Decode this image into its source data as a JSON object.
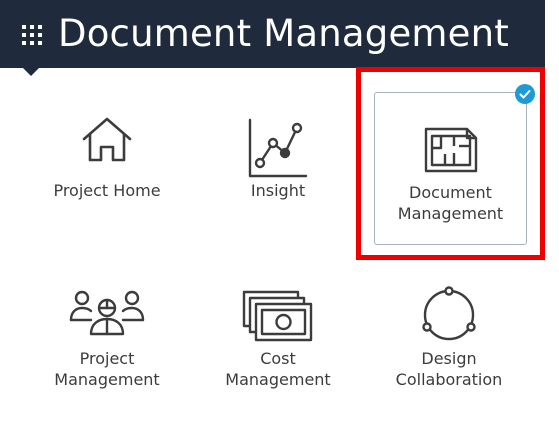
{
  "header": {
    "title": "Document Management",
    "menu_icon": "waffle-grid-icon",
    "background_color": "#1f2b3c"
  },
  "modules": [
    {
      "id": "project-home",
      "line1": "Project Home",
      "line2": "",
      "icon": "house-icon",
      "selected": false
    },
    {
      "id": "insight",
      "line1": "Insight",
      "line2": "",
      "icon": "line-chart-icon",
      "selected": false
    },
    {
      "id": "document-management",
      "line1": "Document",
      "line2": "Management",
      "icon": "floor-plan-document-icon",
      "selected": true
    },
    {
      "id": "project-management",
      "line1": "Project",
      "line2": "Management",
      "icon": "team-people-icon",
      "selected": false
    },
    {
      "id": "cost-management",
      "line1": "Cost",
      "line2": "Management",
      "icon": "banknotes-icon",
      "selected": false
    },
    {
      "id": "design-collaboration",
      "line1": "Design",
      "line2": "Collaboration",
      "icon": "collaboration-circle-icon",
      "selected": false
    }
  ],
  "colors": {
    "highlight": "#ee0000",
    "check_badge": "#1e9bd7",
    "icon_stroke": "#3c3c3c"
  }
}
